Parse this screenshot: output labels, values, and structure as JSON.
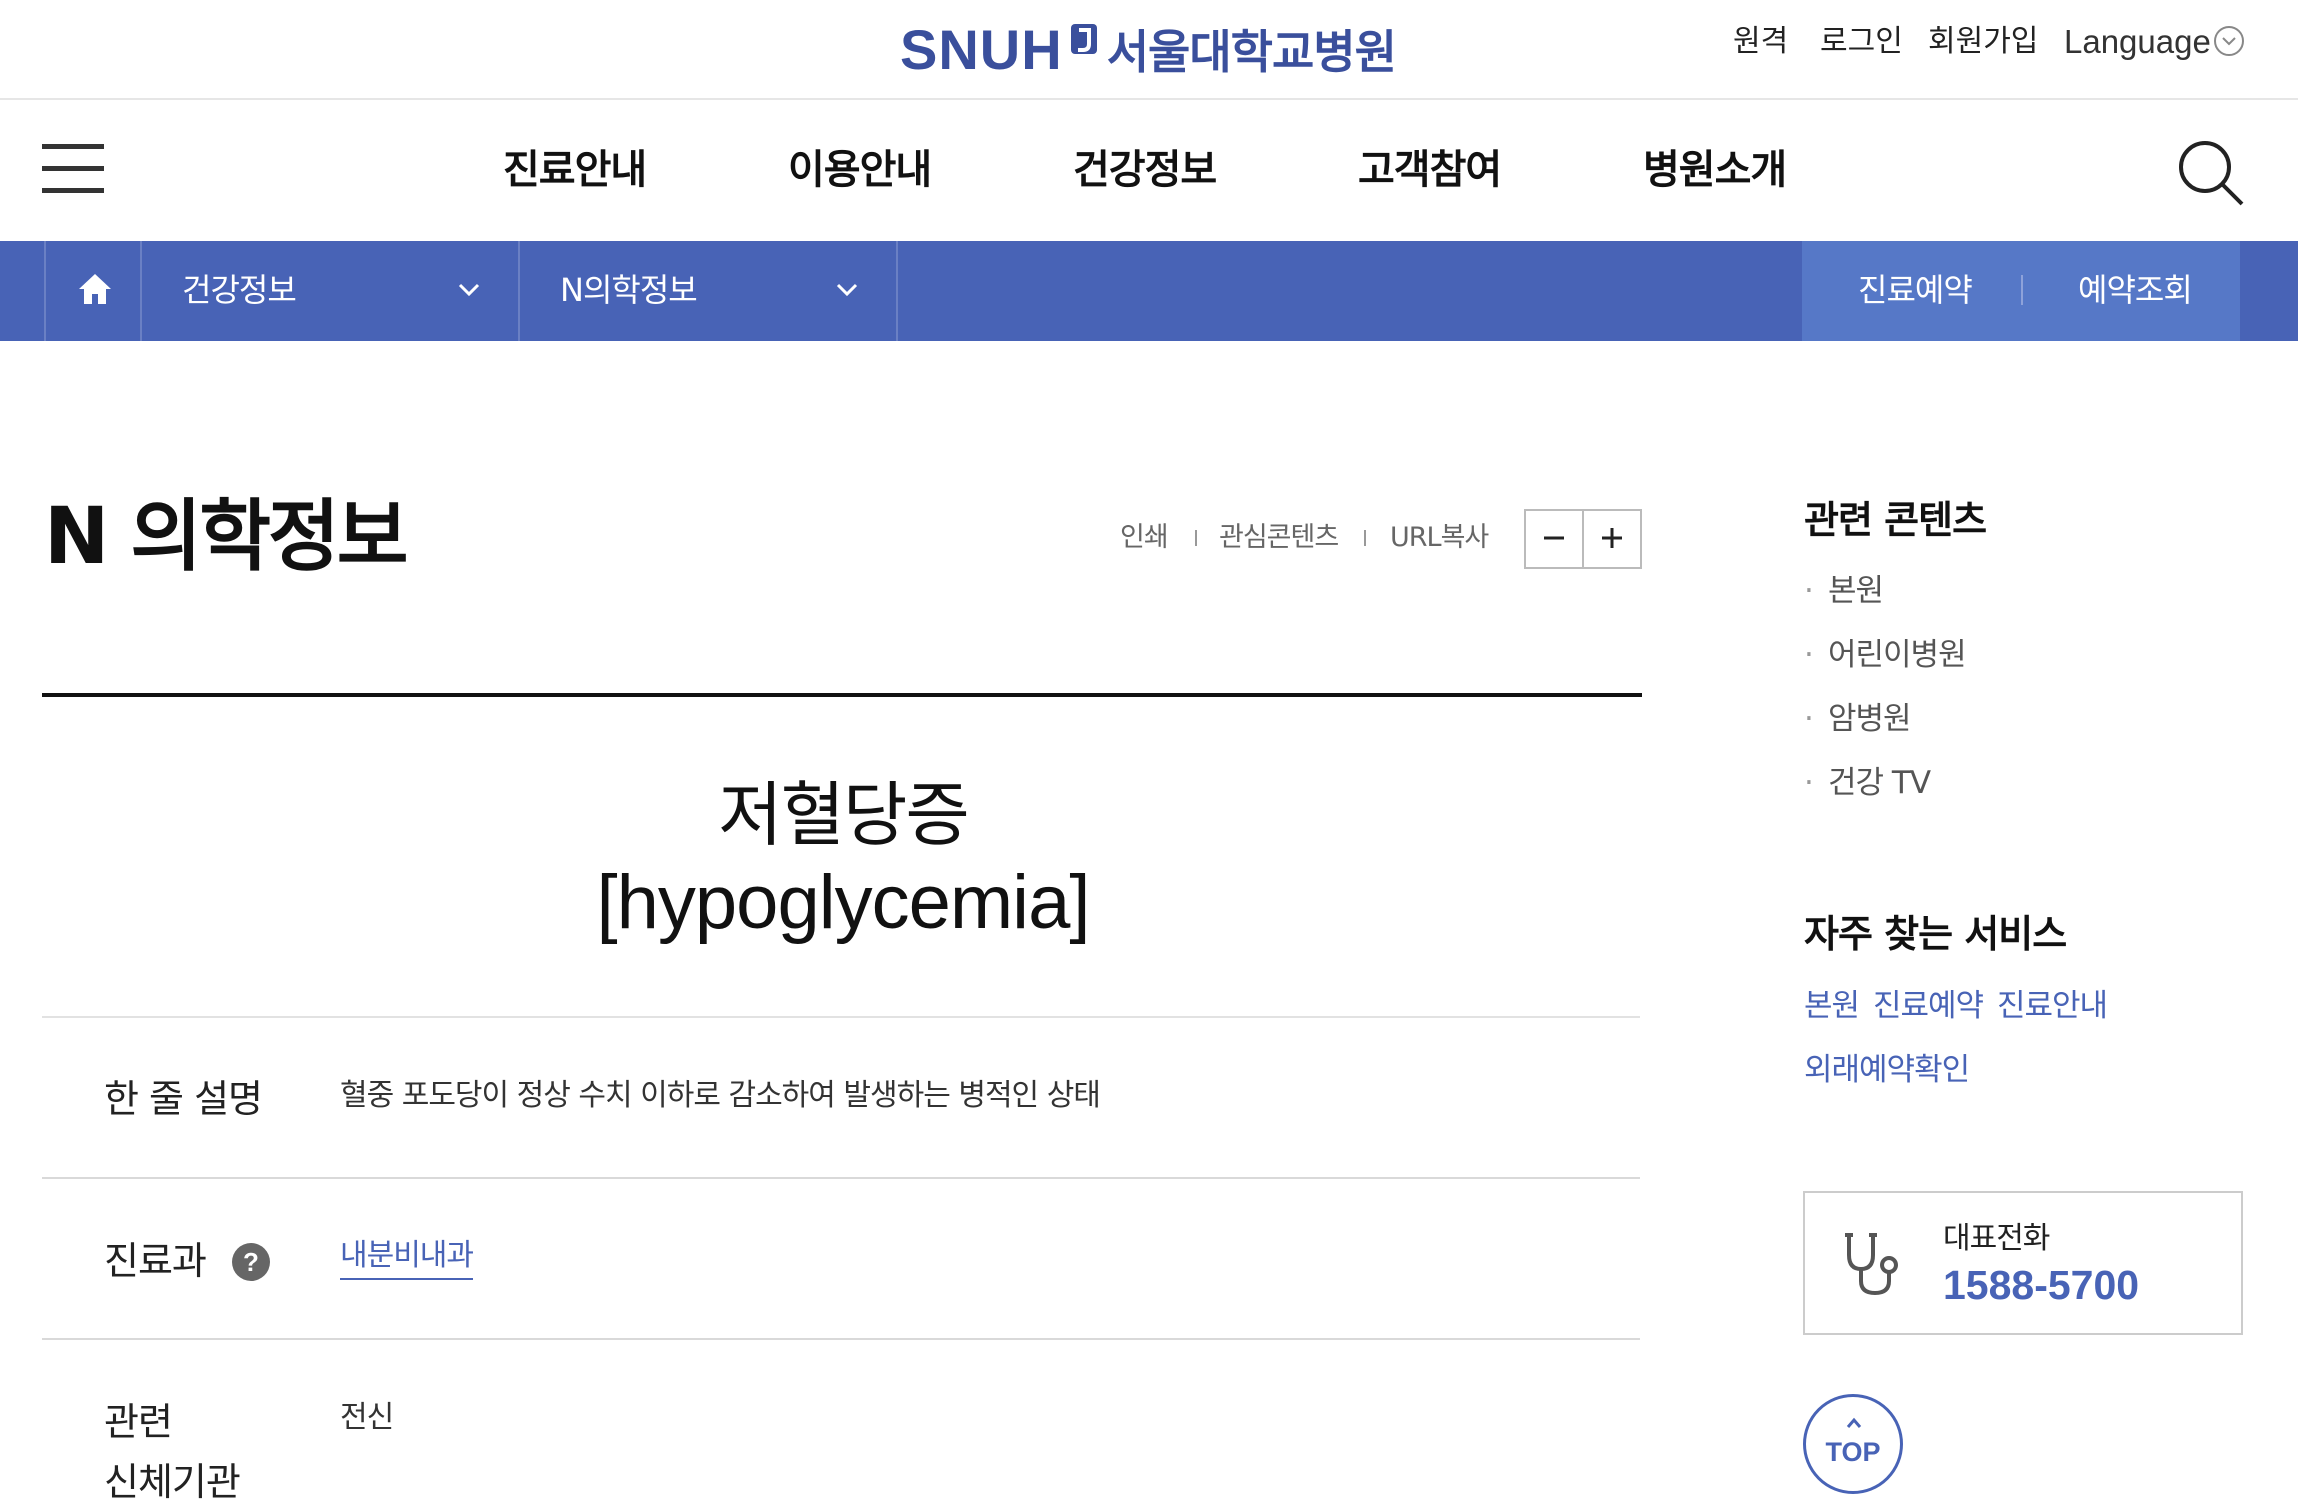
{
  "header": {
    "logo_en": "SNUH",
    "logo_ko": "서울대학교병원",
    "utility_links": [
      "원격",
      "로그인",
      "회원가입"
    ],
    "language_label": "Language"
  },
  "gnb": {
    "items": [
      "진료안내",
      "이용안내",
      "건강정보",
      "고객참여",
      "병원소개"
    ]
  },
  "location_bar": {
    "depth1": "건강정보",
    "depth2": "N의학정보",
    "buttons": [
      "진료예약",
      "예약조회"
    ],
    "background_color": "#4863b6"
  },
  "page": {
    "title": "N 의학정보",
    "tools": [
      "인쇄",
      "관심콘텐츠",
      "URL복사"
    ]
  },
  "disease": {
    "name_ko": "저혈당증",
    "name_en": "[hypoglycemia]"
  },
  "info_rows": [
    {
      "label": "한 줄 설명",
      "value": "혈중 포도당이 정상 수치 이하로 감소하여 발생하는 병적인 상태"
    },
    {
      "label": "진료과",
      "value": "내분비내과"
    },
    {
      "label": "관련\n신체기관",
      "value": "전신"
    }
  ],
  "sidebar": {
    "related_title": "관련 콘텐츠",
    "related_items": [
      "본원",
      "어린이병원",
      "암병원",
      "건강 TV"
    ],
    "services_title": "자주 찾는 서비스",
    "services": [
      "본원",
      "진료예약",
      "진료안내",
      "외래예약확인"
    ],
    "phone_label": "대표전화",
    "phone_number": "1588-5700",
    "top_label": "TOP"
  },
  "colors": {
    "brand_blue": "#4863b6",
    "accent_light_blue": "#5678c7"
  }
}
